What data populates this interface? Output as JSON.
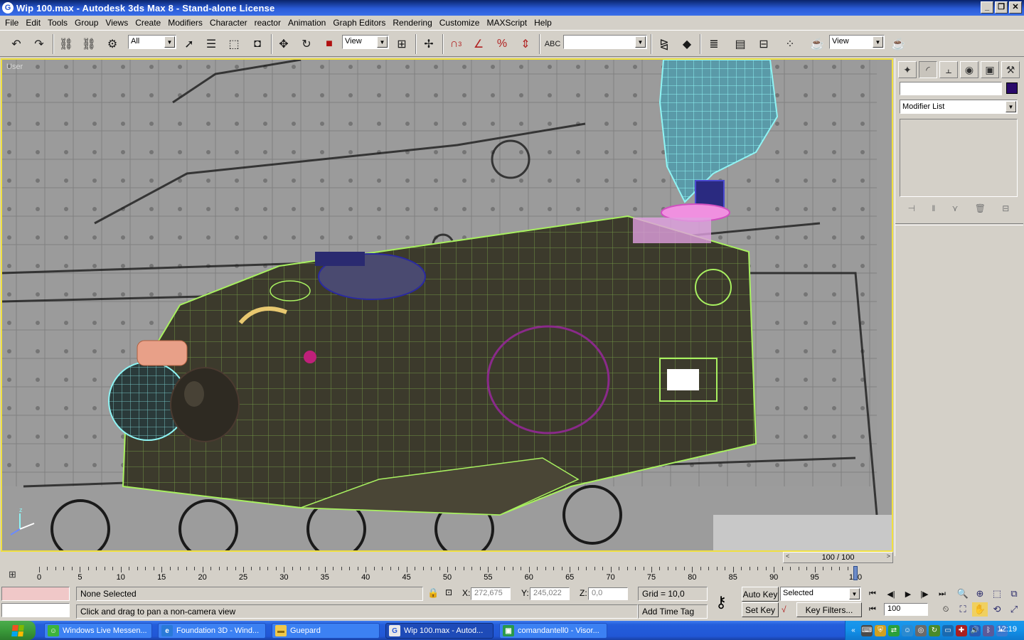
{
  "window": {
    "title": "Wip 100.max - Autodesk 3ds Max 8  - Stand-alone License",
    "app_icon": "3ds-max-icon"
  },
  "menu": [
    "File",
    "Edit",
    "Tools",
    "Group",
    "Views",
    "Create",
    "Modifiers",
    "Character",
    "reactor",
    "Animation",
    "Graph Editors",
    "Rendering",
    "Customize",
    "MAXScript",
    "Help"
  ],
  "toolbar": {
    "selection_filter": "All",
    "ref_coord": "View",
    "named_selection": "",
    "ref_coord2": "View",
    "snap_angle_label": "3"
  },
  "viewport": {
    "label": "User",
    "border_color": "#f0e040",
    "mesh_color": "#3c3a2c",
    "wire_color": "#a8f060"
  },
  "command_panel": {
    "modifier_list": "Modifier List",
    "object_color": "#2a0a6a"
  },
  "time_slider": {
    "label": "100 / 100",
    "current_frame": 100,
    "max_frame": 100
  },
  "ruler_labels": [
    "0",
    "5",
    "10",
    "15",
    "20",
    "25",
    "30",
    "35",
    "40",
    "45",
    "50",
    "55",
    "60",
    "65",
    "70",
    "75",
    "80",
    "85",
    "90",
    "95",
    "100"
  ],
  "status": {
    "selection": "None Selected",
    "prompt": "Click and drag to pan a non-camera view",
    "x_label": "X:",
    "x_value": "272,675",
    "y_label": "Y:",
    "y_value": "245,022",
    "z_label": "Z:",
    "z_value": "0,0",
    "grid": "Grid = 10,0",
    "add_time_tag": "Add Time Tag",
    "auto_key": "Auto Key",
    "set_key": "Set Key",
    "key_mode": "Selected",
    "key_filters": "Key Filters...",
    "frame_field": "100"
  },
  "taskbar": {
    "tasks": [
      {
        "label": "Windows Live Messen...",
        "icon": "messenger-icon",
        "color": "#3cb43c"
      },
      {
        "label": "Foundation 3D - Wind...",
        "icon": "browser-icon",
        "color": "#2a7ad8"
      },
      {
        "label": "Guepard",
        "icon": "folder-icon",
        "color": "#f0c84a"
      },
      {
        "label": "Wip 100.max - Autod...",
        "icon": "3ds-max-icon",
        "color": "#e8e8e8"
      },
      {
        "label": "comandantell0 - Visor...",
        "icon": "image-viewer-icon",
        "color": "#2a9a4a"
      }
    ],
    "clock": "12:19"
  }
}
